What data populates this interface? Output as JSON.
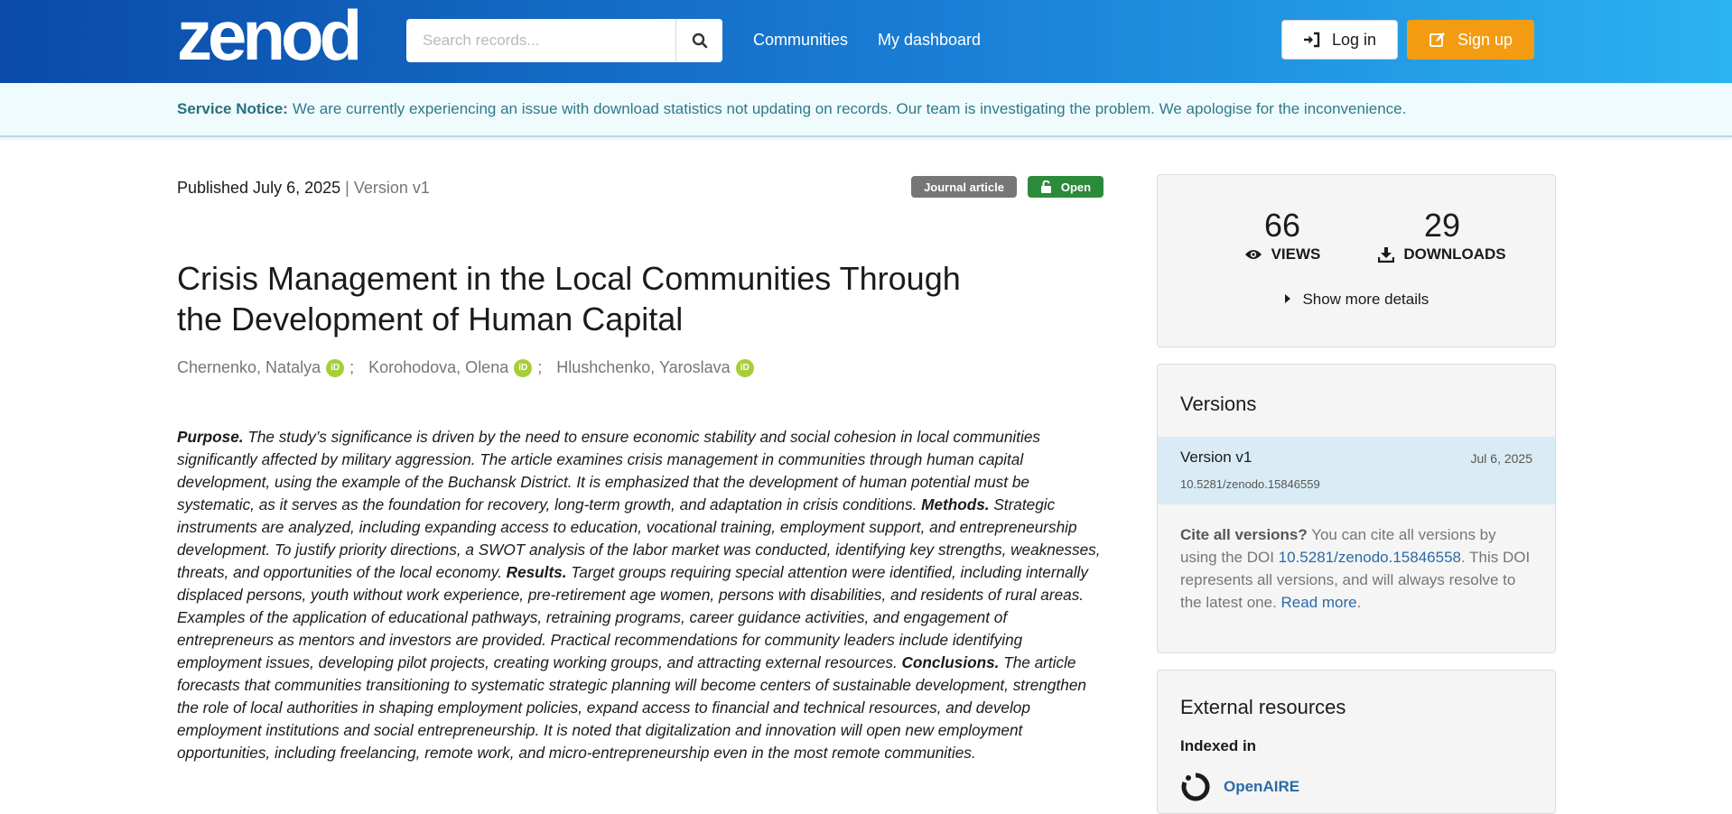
{
  "header": {
    "logo_text": "zenodo",
    "search": {
      "placeholder": "Search records...",
      "value": ""
    },
    "nav": {
      "communities": "Communities",
      "dashboard": "My dashboard"
    },
    "login_label": "Log in",
    "signup_label": "Sign up"
  },
  "notice": {
    "label": "Service Notice:",
    "text": "We are currently experiencing an issue with download statistics not updating on records. Our team is investigating the problem. We apologise for the inconvenience."
  },
  "record": {
    "published": "Published July 6, 2025",
    "version": "| Version v1",
    "resource_type": "Journal article",
    "access": "Open",
    "title": "Crisis Management in the Local Communities Through the Development of Human Capital",
    "creators": [
      "Chernenko, Natalya",
      "Korohodova, Olena",
      "Hlushchenko, Yaroslava"
    ],
    "abstract": {
      "purpose_label": "Purpose.",
      "purpose": " The study’s significance is driven by the need to ensure economic stability and social cohesion in local communities significantly affected by military aggression. The article examines crisis management in communities through human capital development, using the example of the Buchansk District. It is emphasized that the development of human potential must be systematic, as it serves as the foundation for recovery, long-term growth, and adaptation in crisis conditions. ",
      "methods_label": "Methods.",
      "methods": " Strategic instruments are analyzed, including expanding access to education, vocational training, employment support, and entrepreneurship development. To justify priority directions, a SWOT analysis of the labor market was conducted, identifying key strengths, weaknesses, threats, and opportunities of the local economy. ",
      "results_label": "Results.",
      "results": " Target groups requiring special attention were identified, including internally displaced persons, youth without work experience, pre-retirement age women, persons with disabilities, and residents of rural areas. Examples of the application of educational pathways, retraining programs, career guidance activities, and engagement of entrepreneurs as mentors and investors are provided. Practical recommendations for community leaders include identifying employment issues, developing pilot projects, creating working groups, and attracting external resources. ",
      "conclusions_label": "Conclusions.",
      "conclusions": " The article forecasts that communities transitioning to systematic strategic planning will become centers of sustainable development, strengthen the role of local authorities in shaping employment policies, expand access to financial and technical resources, and develop employment institutions and social entrepreneurship. It is noted that digitalization and innovation will open new employment opportunities, including freelancing, remote work, and micro-entrepreneurship even in the most remote communities."
    }
  },
  "stats": {
    "views": "66",
    "views_label": "VIEWS",
    "downloads": "29",
    "downloads_label": "DOWNLOADS",
    "more_details": "Show more details"
  },
  "versions": {
    "heading": "Versions",
    "current": {
      "name": "Version v1",
      "date": "Jul 6, 2025",
      "doi": "10.5281/zenodo.15846559"
    },
    "cite_label": "Cite all versions?",
    "cite_text_1": " You can cite all versions by using the DOI ",
    "cite_doi": "10.5281/zenodo.15846558",
    "cite_text_2": ". This DOI represents all versions, and will always resolve to the latest one. ",
    "read_more": "Read more",
    "cite_text_3": "."
  },
  "external": {
    "heading": "External resources",
    "indexed_label": "Indexed in",
    "openaire": "OpenAIRE"
  },
  "colors": {
    "header_start": "#0a4aa8",
    "header_end": "#2bb2f2",
    "signup": "#f39c12",
    "open_badge": "#2c8a3b",
    "orcid": "#a6ce39",
    "link": "#2a6aa7"
  }
}
